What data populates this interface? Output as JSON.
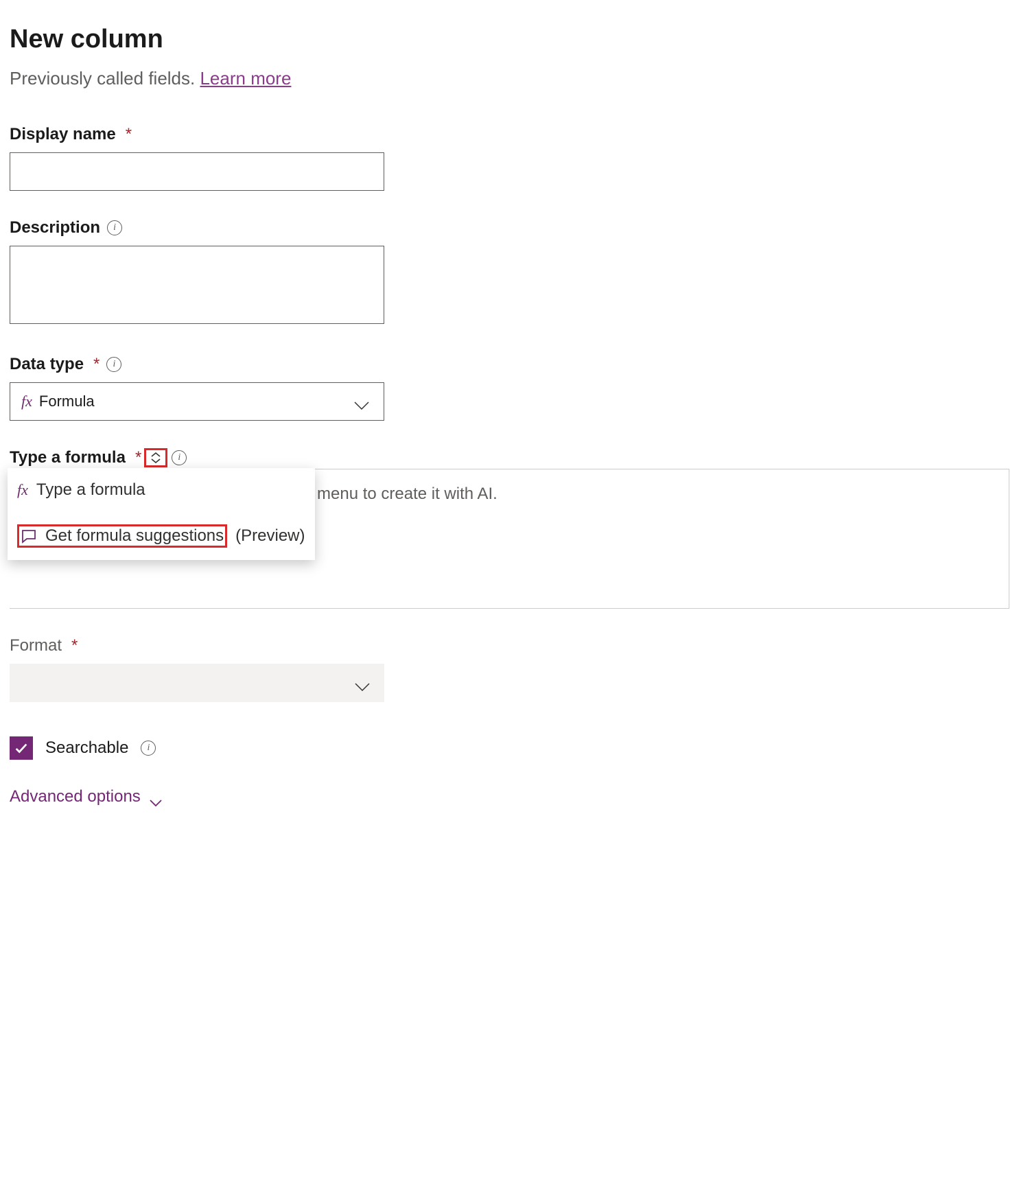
{
  "header": {
    "title": "New column",
    "subtitle_prefix": "Previously called fields. ",
    "learn_more": "Learn more"
  },
  "labels": {
    "display_name": "Display name",
    "description": "Description",
    "data_type": "Data type",
    "type_formula": "Type a formula",
    "format": "Format",
    "searchable": "Searchable",
    "advanced": "Advanced options"
  },
  "data_type": {
    "selected_value": "Formula"
  },
  "formula_dropdown": {
    "option1_label": "Type a formula",
    "option2_label": "Get formula suggestions",
    "option2_suffix": " (Preview)",
    "placeholder_tail": "menu to create it with AI."
  },
  "format": {
    "value": ""
  }
}
